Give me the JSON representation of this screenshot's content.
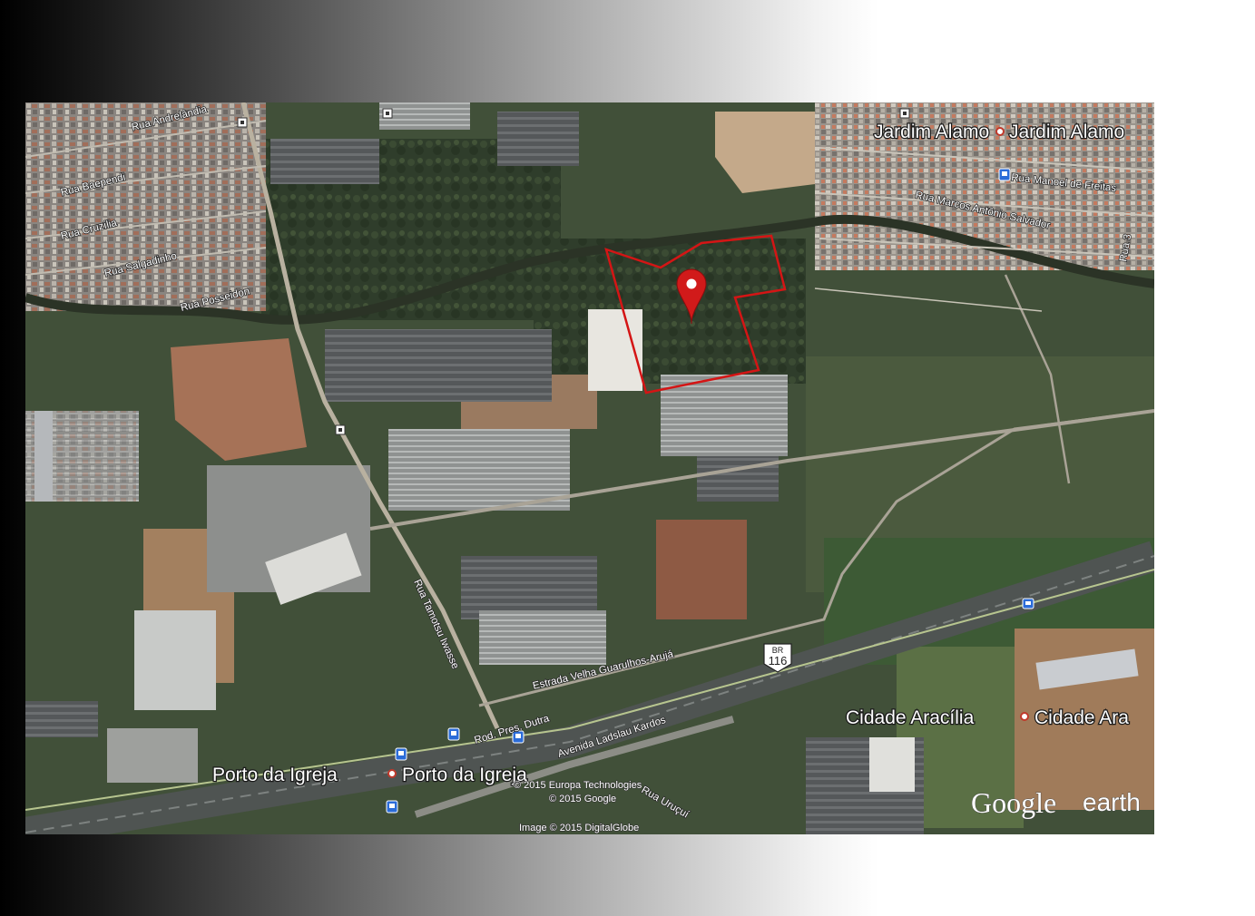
{
  "places": {
    "jardim_alamo_a": "Jardim Alamo",
    "jardim_alamo_b": "Jardim Alamo",
    "cidade_aracilia_a": "Cidade Aracília",
    "cidade_aracilia_b": "Cidade Ara",
    "porto_igreja_a": "Porto da Igreja",
    "porto_igreja_b": "Porto da Igreja"
  },
  "streets": {
    "andrelandia": "Rua Andrelândia",
    "baependi": "Rua Baependi",
    "cruzilia": "Rua Cruzília",
    "salgadinho": "Rua Salgadinho",
    "posseidon": "Rua Posseidon",
    "manoel_freitas": "Rua Manoel de Freitas",
    "marcos_antonio": "Rua Marcos Antônio Salvador",
    "rua3": "Rua 3",
    "tamotsu": "Rua Tamotsu Iwasse",
    "estrada_velha": "Estrada Velha Guarulhos-Arujá",
    "dutra": "Rod. Pres. Dutra",
    "ladslau": "Avenida Ladslau Kardos",
    "urucui": "Rua Uruçuí"
  },
  "shield": {
    "top": "BR",
    "number": "116"
  },
  "credits": {
    "europa": "© 2015 Europa Technologies",
    "google": "© 2015 Google",
    "digitalglobe": "Image © 2015 DigitalGlobe"
  },
  "brand": {
    "google": "Google",
    "earth": "earth"
  },
  "colors": {
    "marker": "#d11a1a",
    "boundary": "#d41515"
  }
}
